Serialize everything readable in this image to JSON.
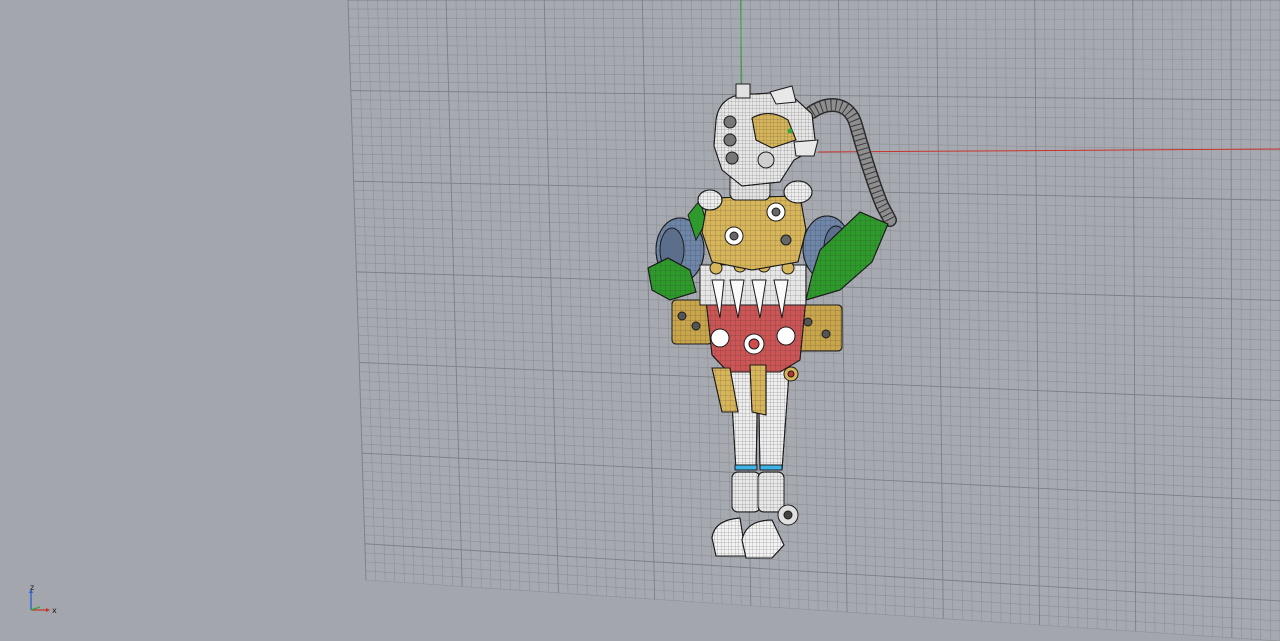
{
  "viewport": {
    "view_type": "perspective",
    "background_color": "#a3a7ad",
    "grid_color": "#8c9199",
    "grid_line_color": "#7a8087"
  },
  "axes": {
    "x_axis_color": "#c8342c",
    "y_axis_color": "#2fa53a",
    "z_label": "z",
    "x_label": "x"
  },
  "model": {
    "display_mode": "shaded-wireframe",
    "colors": {
      "torso": "#d7b55a",
      "pelvis": "#cc5656",
      "shoulder_pads": "#6e86a8",
      "arm_guards": "#2f9a2c",
      "limbs": "#eeeeee",
      "hose": "#8c8c8c",
      "ankle_rings": "#3db3e6"
    }
  }
}
